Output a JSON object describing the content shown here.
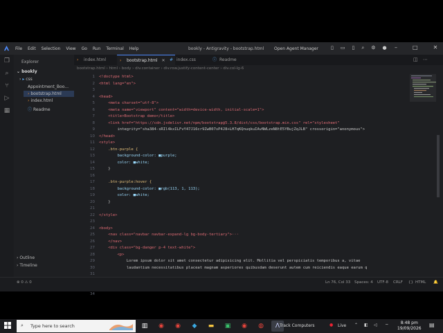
{
  "window": {
    "title": "bookly - Antigravity - bootstrap.html",
    "menu": [
      "File",
      "Edit",
      "Selection",
      "View",
      "Go",
      "Run",
      "Terminal",
      "Help"
    ],
    "agent_manager": "Open Agent Manager"
  },
  "sidebar": {
    "header": "Explorer",
    "root": "bookly",
    "items": [
      {
        "label": "css"
      },
      {
        "label": "Appointment_Boo..."
      },
      {
        "label": "bootstrap.html"
      },
      {
        "label": "index.html"
      },
      {
        "label": "Readme"
      }
    ],
    "outline": "Outline",
    "timeline": "Timeline"
  },
  "tabs": [
    {
      "label": "index.html"
    },
    {
      "label": "bootstrap.html"
    },
    {
      "label": "index.css"
    },
    {
      "label": "Readme"
    }
  ],
  "breadcrumb": [
    "bootstrap.html",
    "html",
    "body",
    "div.container",
    "div.row.justify-content-center",
    "div.col-lg-6"
  ],
  "line_numbers": [
    "1",
    "2",
    "3",
    "4",
    "5",
    "6",
    "7",
    "8",
    "9",
    "10",
    "11",
    "12",
    "13",
    "14",
    "15",
    "16",
    "17",
    "18",
    "19",
    "20",
    "21",
    "22",
    "23",
    "24",
    "25",
    "26",
    "27",
    "28",
    "29",
    "30",
    "31",
    "32",
    "33",
    "34"
  ],
  "code_lines": [
    "<!doctype html>",
    "<html lang=\"en\">",
    "",
    "<head>",
    "    <meta charset=\"utf-8\">",
    "    <meta name=\"viewport\" content=\"width=device-width, initial-scale=1\">",
    "    <title>Bootstrap demo</title>",
    "    <link href=\"https://cdn.jsdelivr.net/npm/bootstrap@5.3.8/dist/css/bootstrap.min.css\" rel=\"stylesheet\"",
    "        integrity=\"sha384-sRIl4kxILFvY47J16cr9ZwB07vP4J8+LH7qKQnuqkuIAvNWLzeN8tE5YBujZqJLB\" crossorigin=\"anonymous\">",
    "</head>",
    "<style>",
    "    .btn-purple {",
    "        background-color: ■purple;",
    "        color: ■white;",
    "    }",
    "",
    "    .btn-purple:hover {",
    "        background-color: ■rgb(113, 1, 113);",
    "        color: ■white;",
    "    }",
    "",
    "</style>",
    "",
    "<body>",
    "    <nav class=\"navbar navbar-expand-lg bg-body-tertiary\">···",
    "    </nav>",
    "    <div class=\"bg-danger p-4 text-white\">",
    "        <p>",
    "            Lorem ipsum dolor sit amet consectetur adipisicing elit. Mollitia vel perspiciatis temporibus a, vitae",
    "            laudantium necessitatibus placeat magnam asperiores quibusdam deserunt autem cum reiciendis eaque earum q"
  ],
  "status": {
    "left": "⊗ 0  ⚠ 0",
    "position": "Ln 76, Col 33",
    "spaces": "Spaces: 4",
    "encoding": "UTF-8",
    "eol": "CRLF",
    "lang": "HTML"
  },
  "taskbar": {
    "search_placeholder": "Type here to search",
    "track": "Track Computers",
    "live": "Live",
    "time": "8:48 pm",
    "date": "19/09/2026"
  }
}
